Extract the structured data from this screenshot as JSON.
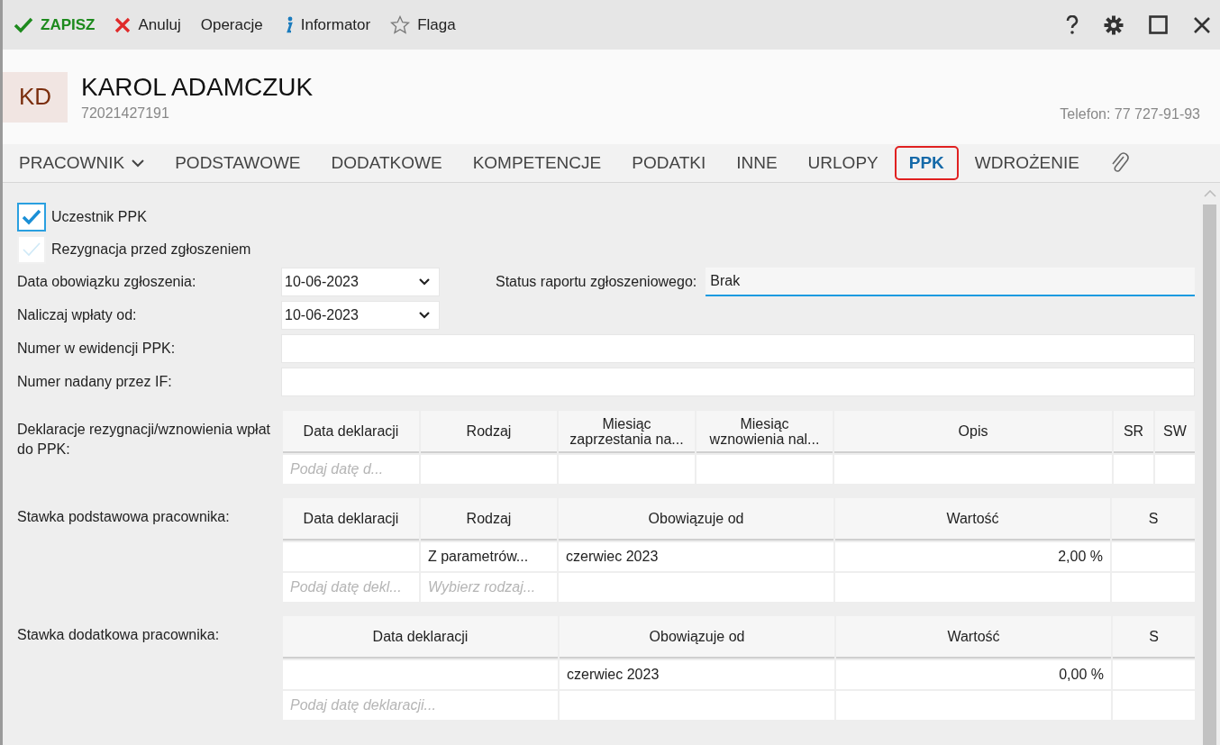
{
  "toolbar": {
    "items": [
      {
        "kind": "save",
        "label": "ZAPISZ"
      },
      {
        "kind": "cancel",
        "label": "Anuluj"
      },
      {
        "kind": "plain",
        "label": "Operacje"
      },
      {
        "kind": "info",
        "label": "Informator"
      },
      {
        "kind": "flag",
        "label": "Flaga"
      }
    ]
  },
  "header": {
    "initials": "KD",
    "name": "KAROL ADAMCZUK",
    "id_number": "72021427191",
    "phone": "Telefon: 77 727-91-93"
  },
  "tabs": [
    {
      "label": "PRACOWNIK",
      "kind": "menu",
      "selected": false
    },
    {
      "label": "PODSTAWOWE",
      "kind": "tab",
      "selected": false
    },
    {
      "label": "DODATKOWE",
      "kind": "tab",
      "selected": false
    },
    {
      "label": "KOMPETENCJE",
      "kind": "tab",
      "selected": false
    },
    {
      "label": "PODATKI",
      "kind": "tab",
      "selected": false
    },
    {
      "label": "INNE",
      "kind": "tab",
      "selected": false
    },
    {
      "label": "URLOPY",
      "kind": "tab",
      "selected": false
    },
    {
      "label": "PPK",
      "kind": "tab",
      "selected": true
    },
    {
      "label": "WDROŻENIE",
      "kind": "tab",
      "selected": false
    }
  ],
  "checkboxes": [
    {
      "label": "Uczestnik PPK",
      "checked": true
    },
    {
      "label": "Rezygnacja przed zgłoszeniem",
      "checked": false
    }
  ],
  "fields": [
    {
      "label": "Data obowiązku zgłoszenia:",
      "kind": "date",
      "value": "10-06-2023",
      "side": {
        "label": "Status raportu zgłoszeniowego:",
        "value": "Brak"
      }
    },
    {
      "label": "Naliczaj wpłaty od:",
      "kind": "date",
      "value": "10-06-2023"
    },
    {
      "label": "Numer w ewidencji PPK:",
      "kind": "text"
    },
    {
      "label": "Numer nadany przez IF:",
      "kind": "text"
    }
  ],
  "tables": [
    {
      "label": "Deklaracje rezygnacji/wznowienia wpłat do PPK:",
      "kind": "declarations",
      "columns": [
        {
          "label": "Data deklaracji"
        },
        {
          "label": "Rodzaj"
        },
        {
          "label": "Miesiąc zaprzestania na..."
        },
        {
          "label": "Miesiąc wznowienia nal..."
        },
        {
          "label": "Opis"
        },
        {
          "label": "SR"
        },
        {
          "label": "SW"
        }
      ],
      "rows": [
        {
          "cells": [
            {
              "placeholder": "Podaj datę d..."
            },
            {},
            {},
            {},
            {},
            {},
            {}
          ]
        }
      ]
    },
    {
      "label": "Stawka podstawowa pracownika:",
      "kind": "basic",
      "columns": [
        {
          "label": "Data deklaracji"
        },
        {
          "label": "Rodzaj"
        },
        {
          "label": "Obowiązuje od"
        },
        {
          "label": "Wartość"
        },
        {
          "label": "S"
        }
      ],
      "rows": [
        {
          "cells": [
            {},
            {
              "text": "Z parametrów..."
            },
            {
              "text": "czerwiec 2023"
            },
            {
              "text": "2,00 %",
              "kind": "number"
            },
            {}
          ]
        },
        {
          "cells": [
            {
              "placeholder": "Podaj datę dekl..."
            },
            {
              "placeholder": "Wybierz rodzaj..."
            },
            {},
            {},
            {}
          ]
        }
      ]
    },
    {
      "label": "Stawka dodatkowa pracownika:",
      "kind": "extra",
      "columns": [
        {
          "label": "Data deklaracji"
        },
        {
          "label": "Obowiązuje od"
        },
        {
          "label": "Wartość"
        },
        {
          "label": "S"
        }
      ],
      "rows": [
        {
          "cells": [
            {},
            {
              "text": "czerwiec 2023"
            },
            {
              "text": "0,00 %",
              "kind": "number"
            },
            {}
          ]
        },
        {
          "cells": [
            {
              "placeholder": "Podaj datę deklaracji..."
            },
            {},
            {},
            {}
          ]
        }
      ]
    }
  ]
}
